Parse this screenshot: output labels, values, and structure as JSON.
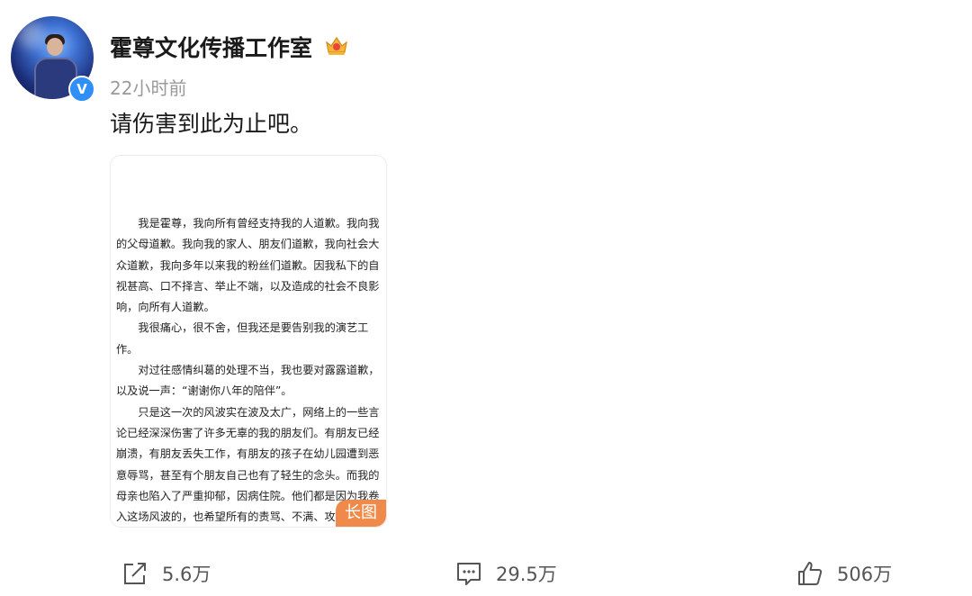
{
  "post": {
    "author": "霍尊文化传播工作室",
    "timestamp": "22小时前",
    "text": "请伤害到此为止吧。",
    "verified_badge": "V",
    "crown_badge_icon": "vip-crown-icon",
    "image_tag": "长图",
    "letter_paragraphs": [
      "我是霍尊，我向所有曾经支持我的人道歉。我向我的父母道歉。我向我的家人、朋友们道歉，我向社会大众道歉，我向多年以来我的粉丝们道歉。因我私下的自视甚高、口不择言、举止不端，以及造成的社会不良影响，向所有人道歉。",
      "我很痛心，很不舍，但我还是要告别我的演艺工作。",
      "对过往感情纠葛的处理不当，我也要对露露道歉，以及说一声：“谢谢你八年的陪伴”。",
      "只是这一次的风波实在波及太广，网络上的一些言论已经深深伤害了许多无辜的我的朋友们。有朋友已经崩溃，有朋友丢失工作，有朋友的孩子在幼儿园遭到恶意辱骂，甚至有个朋友自己也有了轻生的念头。而我的母亲也陷入了严重抑郁，因病住院。他们都是因为我卷入这场风波的，也希望所有的责骂、不满、攻讦都发泄在我身上，我愿意扛下这一切，做一个男人最后能做的事。在这里，我恳请善待他们。"
    ]
  },
  "actions": {
    "repost": {
      "icon": "share-icon",
      "count": "5.6万"
    },
    "comment": {
      "icon": "comment-icon",
      "count": "29.5万"
    },
    "like": {
      "icon": "thumbs-up-icon",
      "count": "506万"
    }
  }
}
